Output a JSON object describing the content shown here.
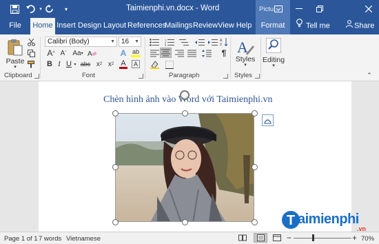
{
  "titlebar": {
    "document_title": "Taimienphi.vn.docx - Word",
    "contextual_tab_group": "Pictu...",
    "icons": [
      "save-icon",
      "undo-icon",
      "redo-icon",
      "customize-toolbar-icon",
      "ribbon-display-icon",
      "minimize-icon",
      "restore-icon",
      "close-icon"
    ]
  },
  "tabs": [
    "File",
    "Home",
    "Insert",
    "Design",
    "Layout",
    "References",
    "Mailings",
    "Review",
    "View",
    "Help",
    "Format"
  ],
  "active_tab": "Home",
  "tell_me": "Tell me",
  "share": "Share",
  "ribbon": {
    "clipboard": {
      "paste": "Paste",
      "label": "Clipboard"
    },
    "font": {
      "font_name": "Calibri (Body)",
      "font_size": "16",
      "grow": "A",
      "shrink": "A",
      "change_case": "Aa",
      "bold": "B",
      "italic": "I",
      "underline": "U",
      "strikethrough": "abc",
      "subscript": "x",
      "sub_mark": "2",
      "superscript": "x",
      "sup_mark": "2",
      "text_effects": "A",
      "highlight": "ab",
      "font_color": "A",
      "label": "Font"
    },
    "paragraph": {
      "label": "Paragraph"
    },
    "styles": {
      "styles": "Styles",
      "label": "Styles"
    },
    "editing": {
      "editing": "Editing"
    }
  },
  "document": {
    "heading": "Chèn hình ảnh vào Word với Taimienphi.vn"
  },
  "watermark": {
    "brand": "aimienphi",
    "brand_initial": "T",
    "tld": ".vn"
  },
  "statusbar": {
    "page": "Page 1 of 1",
    "words": "7 words",
    "language": "Vietnamese",
    "zoom_minus": "−",
    "zoom_plus": "+",
    "zoom": "70%",
    "zoom_level": 0.7
  },
  "colors": {
    "brand": "#2b579a",
    "heading": "#2f5496",
    "highlight": "#ffff00",
    "font_color": "#c00000"
  }
}
